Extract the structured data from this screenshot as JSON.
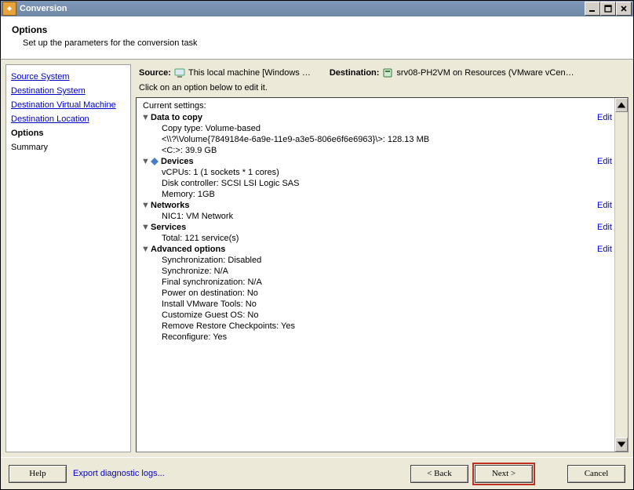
{
  "window": {
    "title": "Conversion"
  },
  "header": {
    "title": "Options",
    "subtitle": "Set up the parameters for the conversion task"
  },
  "sidebar": {
    "items": [
      "Source System",
      "Destination System",
      "Destination Virtual Machine",
      "Destination Location",
      "Options",
      "Summary"
    ]
  },
  "srcbar": {
    "source_label": "Source:",
    "source_value": "This local machine [Windows …",
    "dest_label": "Destination:",
    "dest_value": "srv08-PH2VM on Resources (VMware vCen…"
  },
  "instruction": "Click on an option below to edit it.",
  "panel": {
    "caption": "Current settings:",
    "edit_label": "Edit",
    "sections": [
      {
        "title": "Data to copy",
        "edit": true,
        "rows": [
          "Copy type: Volume-based",
          "<\\\\?\\Volume{7849184e-6a9e-11e9-a3e5-806e6f6e6963}\\>: 128.13 MB",
          "<C:>: 39.9 GB"
        ]
      },
      {
        "title": "Devices",
        "edit": true,
        "diamond": true,
        "rows": [
          "vCPUs: 1 (1 sockets * 1 cores)",
          "Disk controller: SCSI LSI Logic SAS",
          "Memory: 1GB"
        ]
      },
      {
        "title": "Networks",
        "edit": true,
        "rows": [
          "NIC1: VM Network"
        ]
      },
      {
        "title": "Services",
        "edit": true,
        "rows": [
          "Total: 121 service(s)"
        ]
      },
      {
        "title": "Advanced options",
        "edit": true,
        "rows": [
          "Synchronization: Disabled",
          "Synchronize: N/A",
          "Final synchronization: N/A",
          "Power on destination: No",
          "Install VMware Tools: No",
          "Customize Guest OS: No",
          "Remove Restore Checkpoints: Yes",
          "Reconfigure: Yes"
        ]
      }
    ]
  },
  "footer": {
    "help": "Help",
    "export": "Export diagnostic logs...",
    "back": "< Back",
    "next": "Next >",
    "cancel": "Cancel"
  }
}
